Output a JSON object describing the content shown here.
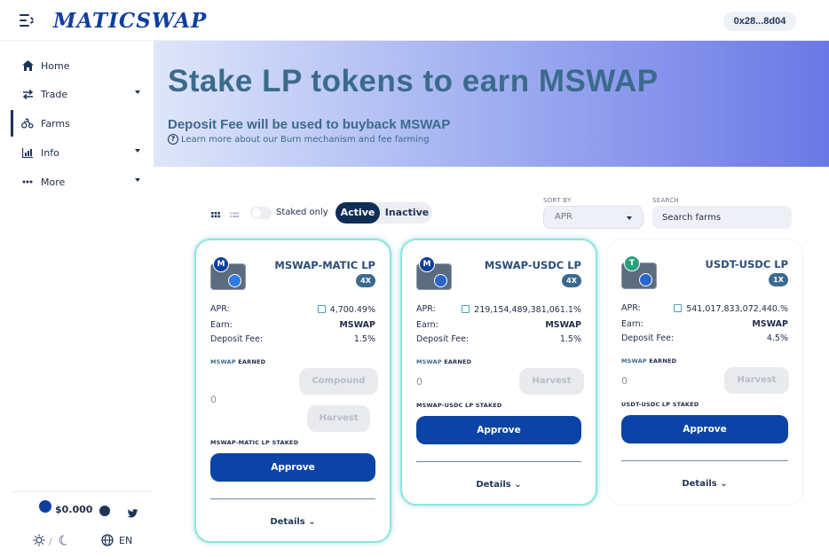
{
  "header": {
    "logo": "MATICSWAP",
    "wallet": "0x28...8d04"
  },
  "sidebar": {
    "items": [
      {
        "label": "Home",
        "icon": "home-icon"
      },
      {
        "label": "Trade",
        "icon": "swap-icon"
      },
      {
        "label": "Farms",
        "icon": "farm-icon"
      },
      {
        "label": "Info",
        "icon": "chart-icon"
      },
      {
        "label": "More",
        "icon": "dots-icon"
      }
    ],
    "price": "$0.000",
    "lang": "EN"
  },
  "hero": {
    "title": "Stake LP tokens to earn MSWAP",
    "subtitle": "Deposit Fee will be used to buyback MSWAP",
    "link": "Learn more about our Burn mechanism and fee farming"
  },
  "controls": {
    "staked_only": "Staked only",
    "active": "Active",
    "inactive": "Inactive",
    "sort_label": "SORT BY",
    "sort_value": "APR",
    "search_label": "SEARCH",
    "search_placeholder": "Search farms"
  },
  "farm_labels": {
    "apr": "APR:",
    "earn": "Earn:",
    "fee": "Deposit Fee:",
    "earned_token": "MSWAP",
    "earned_suffix": "EARNED",
    "compound": "Compound",
    "harvest": "Harvest",
    "approve": "Approve",
    "details": "Details"
  },
  "farms": [
    {
      "name": "MSWAP-MATIC LP",
      "multiplier": "4X",
      "apr": "4,700.49%",
      "earn": "MSWAP",
      "fee": "1.5%",
      "earned": "0",
      "staked_label": "MSWAP-MATIC LP STAKED"
    },
    {
      "name": "MSWAP-USDC LP",
      "multiplier": "4X",
      "apr": "219,154,489,381,061.1%",
      "earn": "MSWAP",
      "fee": "1.5%",
      "earned": "0",
      "staked_label": "MSWAP-USDC LP STAKED"
    },
    {
      "name": "USDT-USDC LP",
      "multiplier": "1X",
      "apr": "541,017,833,072,440.%",
      "earn": "MSWAP",
      "fee": "4.5%",
      "earned": "0",
      "staked_label": "USDT-USDC LP STAKED"
    }
  ],
  "colors": {
    "brand": "#0f3f9e",
    "approve": "#0b44a6",
    "accent": "#3b6b8c"
  }
}
